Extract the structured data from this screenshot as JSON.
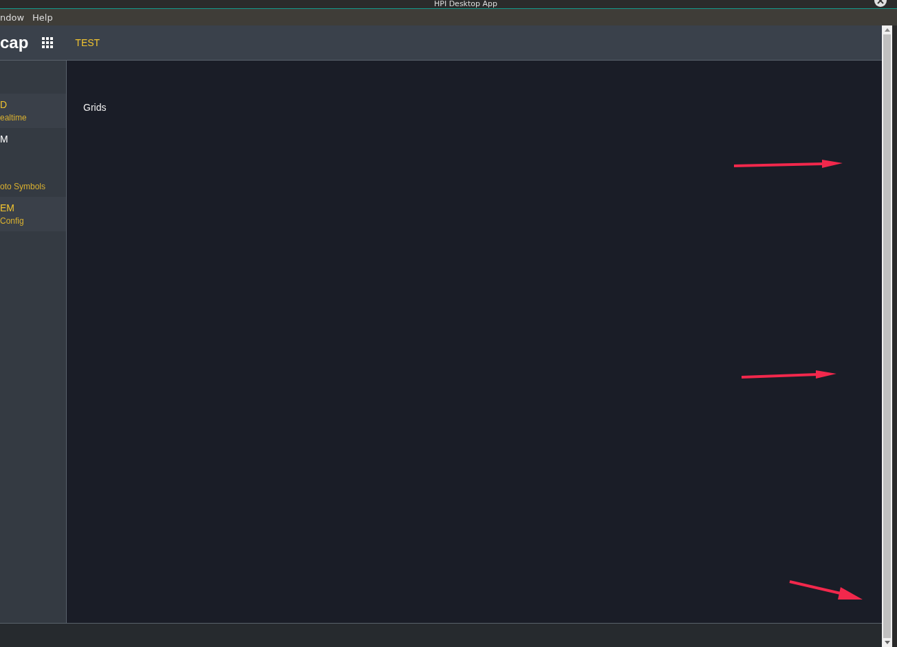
{
  "window": {
    "title": "HPI Desktop App"
  },
  "menu": [
    "ndow",
    "Help"
  ],
  "header": {
    "logo": "cap",
    "tab": "TEST"
  },
  "sidebar": {
    "items": [
      {
        "title": "D",
        "subtitle": "ealtime",
        "highlighted": true
      },
      {
        "title": "M",
        "subtitle": "oto Symbols",
        "highlighted": false
      },
      {
        "title": "EM",
        "subtitle": "Config",
        "highlighted": true
      }
    ]
  },
  "main": {
    "heading": "Grids"
  }
}
